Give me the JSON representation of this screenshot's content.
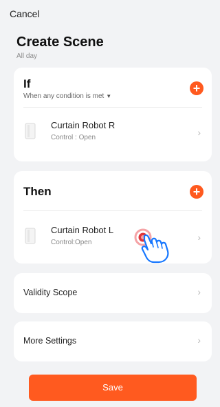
{
  "header": {
    "cancel_label": "Cancel",
    "title": "Create Scene",
    "subtitle": "All day"
  },
  "if_section": {
    "title": "If",
    "condition_mode": "When any condition is met",
    "add_icon": "plus-icon",
    "device": {
      "name": "Curtain Robot  R",
      "action": "Control : Open",
      "icon": "curtain-device-icon"
    }
  },
  "then_section": {
    "title": "Then",
    "add_icon": "plus-icon",
    "device": {
      "name": "Curtain Robot  L",
      "action": "Control:Open",
      "icon": "curtain-device-icon"
    }
  },
  "validity_scope": {
    "label": "Validity Scope"
  },
  "more_settings": {
    "label": "More Settings"
  },
  "footer": {
    "save_label": "Save"
  },
  "colors": {
    "accent": "#ff5a1f",
    "background": "#f2f3f5",
    "card": "#ffffff",
    "hand_outline": "#1677ff",
    "tap_indicator": "#e0353b"
  }
}
